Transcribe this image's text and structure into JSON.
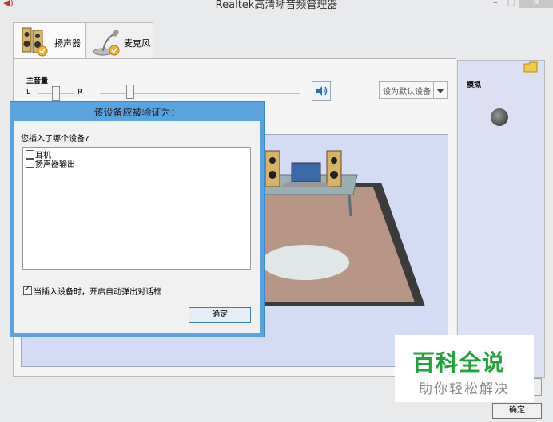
{
  "window": {
    "title": "Realtek高清晰音频管理器",
    "min": "–",
    "max": "□",
    "close": "✕"
  },
  "tabs": [
    {
      "label": "扬声器",
      "icon": "speakers-icon"
    },
    {
      "label": "麦克风",
      "icon": "microphone-icon"
    }
  ],
  "volume": {
    "label": "主音量",
    "left": "L",
    "right": "R",
    "balance": 0.5,
    "level": 0.15
  },
  "default_device": {
    "label": "设为默认设备"
  },
  "connector": {
    "label": "模拟"
  },
  "dialog": {
    "title": "该设备应被验证为：",
    "question": "您插入了哪个设备?",
    "options": [
      {
        "label": "耳机",
        "checked": false
      },
      {
        "label": "扬声器输出",
        "checked": false
      }
    ],
    "auto_popup": {
      "label": "当插入设备时，开启自动弹出对话框",
      "checked": true
    },
    "ok": "确定"
  },
  "main_ok": "确定",
  "watermark": {
    "line1": "百科全说",
    "line2": "助你轻松解决"
  }
}
